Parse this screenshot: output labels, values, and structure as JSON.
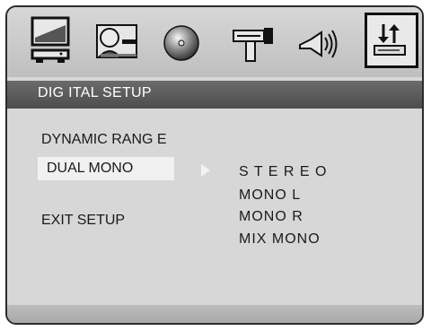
{
  "icon_bar": {
    "icons": [
      {
        "name": "tv-monitor-icon",
        "selected": false
      },
      {
        "name": "person-settings-icon",
        "selected": false
      },
      {
        "name": "disc-icon",
        "selected": false
      },
      {
        "name": "video-camera-icon",
        "selected": false
      },
      {
        "name": "speaker-sound-icon",
        "selected": false
      },
      {
        "name": "digital-setup-icon",
        "selected": true
      }
    ]
  },
  "header": {
    "title": "DIG ITAL SETUP"
  },
  "menu": {
    "items": [
      {
        "label": "DYNAMIC  RANG E",
        "highlighted": false
      },
      {
        "label": "DUAL MONO",
        "highlighted": true
      },
      {
        "label": "EXIT SETUP",
        "highlighted": false
      }
    ]
  },
  "options": [
    "S T E R E O",
    "MONO L",
    "MONO R",
    "MIX MONO"
  ],
  "colors": {
    "header_bg": "#5a5a5a",
    "panel_bg": "#d7d7d7",
    "highlight_bg": "#f1f1f1"
  }
}
